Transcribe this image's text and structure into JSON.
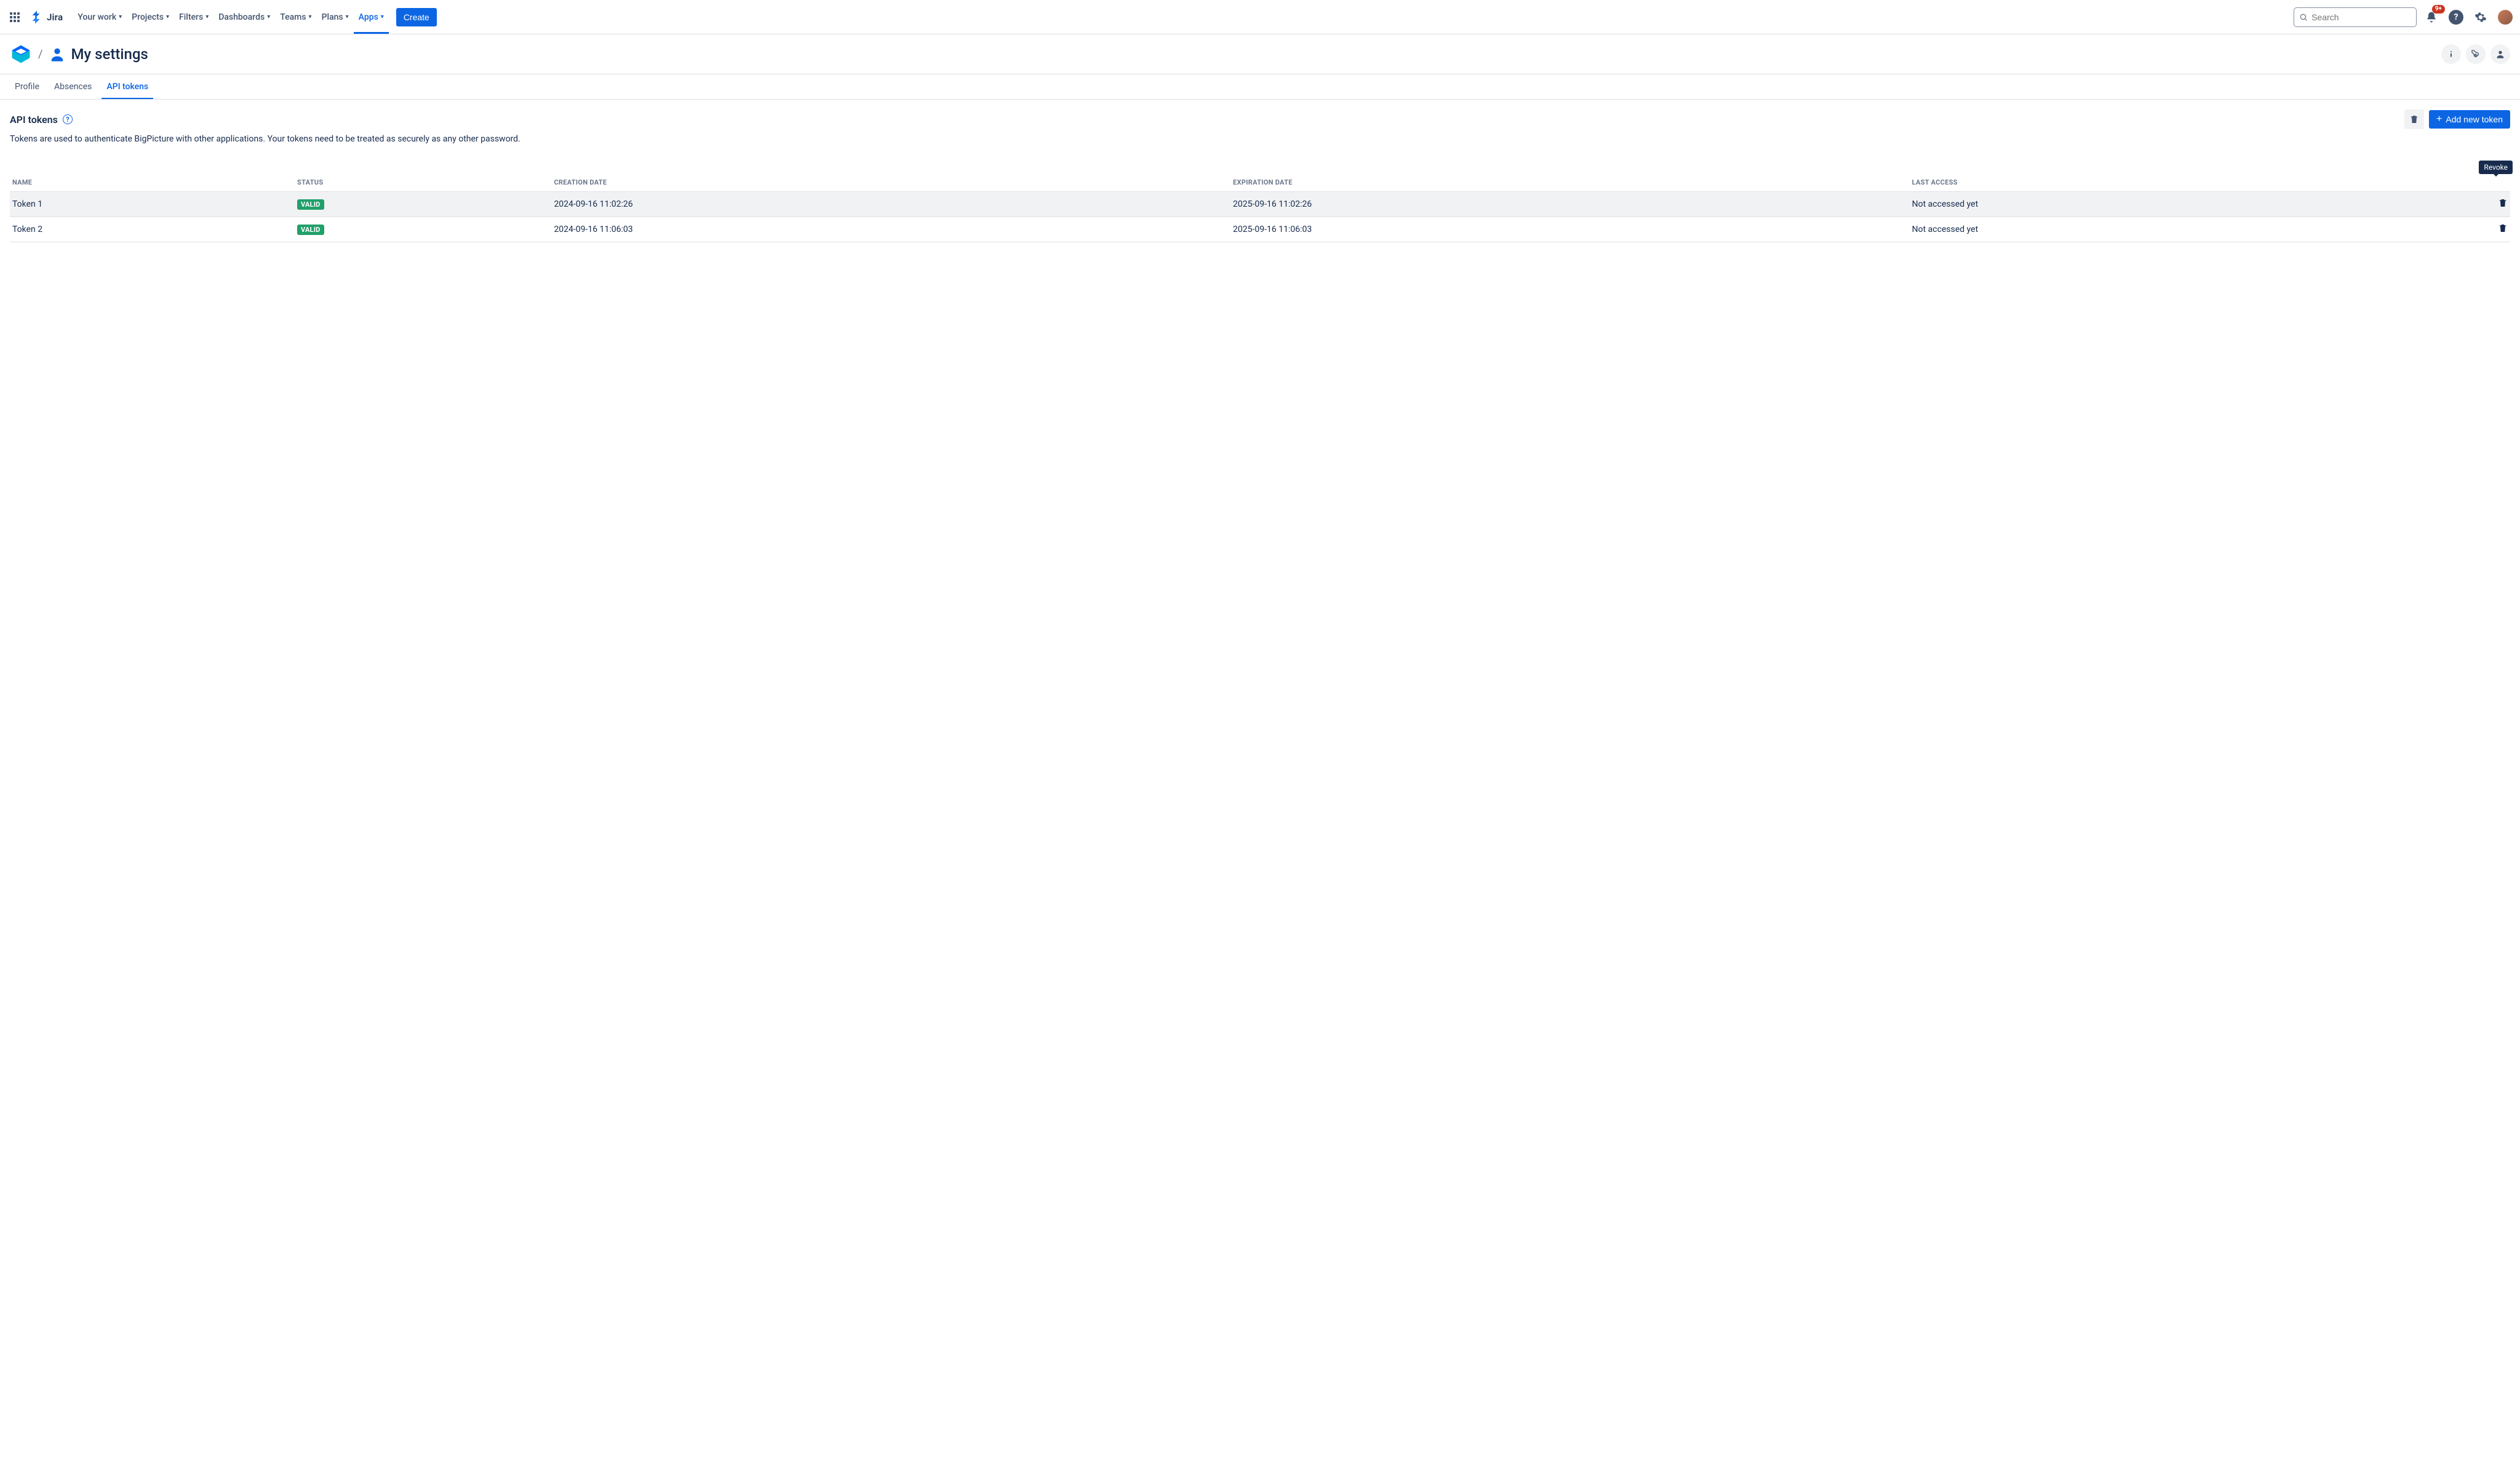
{
  "nav": {
    "product": "Jira",
    "items": [
      "Your work",
      "Projects",
      "Filters",
      "Dashboards",
      "Teams",
      "Plans",
      "Apps"
    ],
    "active_index": 6,
    "create": "Create",
    "search_placeholder": "Search",
    "notification_badge": "9+"
  },
  "header": {
    "title": "My settings"
  },
  "tabs": {
    "items": [
      "Profile",
      "Absences",
      "API tokens"
    ],
    "active_index": 2
  },
  "section": {
    "title": "API tokens",
    "description": "Tokens are used to authenticate BigPicture with other applications. Your tokens need to be treated as securely as any other password.",
    "add_button": "Add new token",
    "tooltip": "Revoke"
  },
  "table": {
    "columns": [
      "NAME",
      "STATUS",
      "CREATION DATE",
      "EXPIRATION DATE",
      "LAST ACCESS"
    ],
    "rows": [
      {
        "name": "Token 1",
        "status": "VALID",
        "created": "2024-09-16 11:02:26",
        "expires": "2025-09-16 11:02:26",
        "last_access": "Not accessed yet",
        "hovered": true
      },
      {
        "name": "Token 2",
        "status": "VALID",
        "created": "2024-09-16 11:06:03",
        "expires": "2025-09-16 11:06:03",
        "last_access": "Not accessed yet",
        "hovered": false
      }
    ]
  }
}
